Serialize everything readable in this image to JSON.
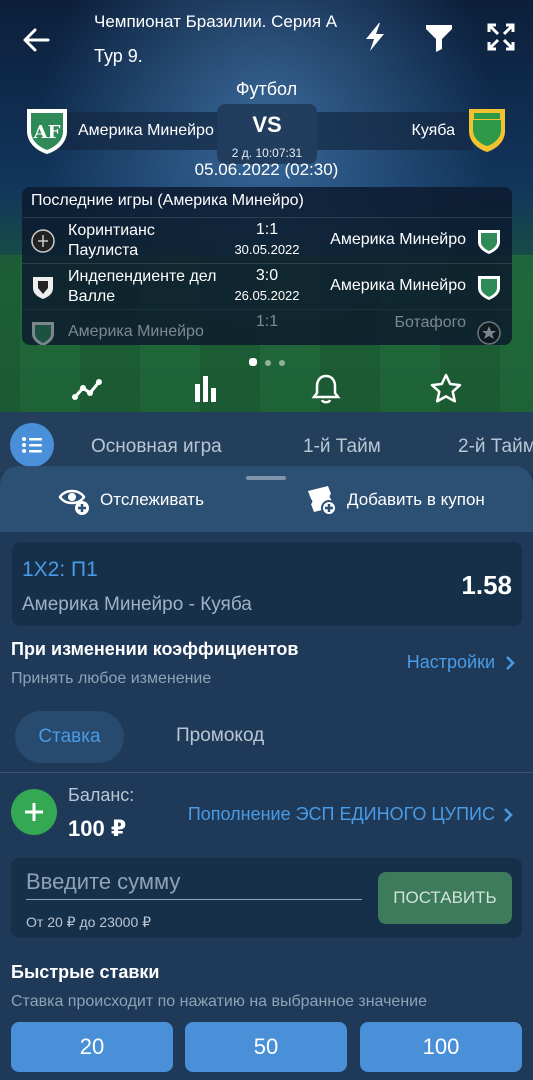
{
  "header": {
    "league": "Чемпионат Бразилии. Серия А",
    "round": "Тур 9.",
    "back_icon": "arrow-left-icon",
    "icons": [
      "lightning-icon",
      "filter-icon",
      "fullscreen-icon"
    ]
  },
  "match": {
    "sport": "Футбол",
    "home_team": "Америка Минейро",
    "away_team": "Куяба",
    "vs_label": "VS",
    "countdown": "2 д. 10:07:31",
    "date": "05.06.2022 (02:30)"
  },
  "recent_games": {
    "title": "Последние игры (Америка Минейро)",
    "rows": [
      {
        "home": "Коринтианс Паулиста",
        "score": "1:1",
        "date": "30.05.2022",
        "away": "Америка Минейро"
      },
      {
        "home": "Индепендиенте дел Валле",
        "score": "3:0",
        "date": "26.05.2022",
        "away": "Америка Минейро"
      },
      {
        "home": "Америка Минейро",
        "score": "1:1",
        "date": "",
        "away": "Ботафого"
      }
    ]
  },
  "actions": [
    "stats-line-icon",
    "bar-chart-icon",
    "bell-icon",
    "star-icon"
  ],
  "tabs": {
    "items": [
      "Основная игра",
      "1-й Тайм",
      "2-й Тайм"
    ]
  },
  "sheet": {
    "track_label": "Отслеживать",
    "add_coupon_label": "Добавить в купон",
    "bet": {
      "market": "1X2: П1",
      "match": "Америка Минейро - Куяба",
      "odds": "1.58"
    },
    "odds_change": {
      "title": "При изменении коэффициентов",
      "subtitle": "Принять любое изменение",
      "settings_label": "Настройки"
    },
    "segments": {
      "bet": "Ставка",
      "promo": "Промокод"
    },
    "balance": {
      "label": "Баланс:",
      "value": "100 ₽",
      "topup_label": "Пополнение ЭСП ЕДИНОГО ЦУПИС"
    },
    "amount": {
      "placeholder": "Введите сумму",
      "range": "От 20 ₽ до 23000 ₽",
      "place_label": "ПОСТАВИТЬ"
    },
    "quick_bets": {
      "title": "Быстрые ставки",
      "subtitle": "Ставка происходит по нажатию на выбранное значение",
      "values": [
        "20",
        "50",
        "100"
      ]
    }
  },
  "colors": {
    "accent_blue": "#4a9be6",
    "button_blue": "#4a90d9",
    "green": "#34a853",
    "sheet_bg": "#1e3a58"
  }
}
